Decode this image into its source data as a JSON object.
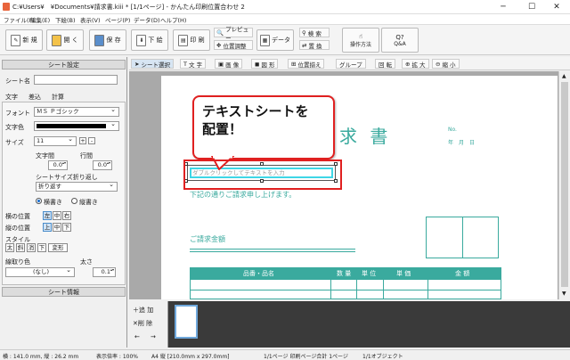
{
  "title": "C:¥Users¥　¥Documents¥請求書.kiii * [1/1ページ] - かんたん印刷位置合わせ 2",
  "menu": [
    "ファイル(F)",
    "編集(E)",
    "下絵(B)",
    "表示(V)",
    "ページ(P)",
    "データ(D)",
    "ヘルプ(H)"
  ],
  "toolbar": {
    "new": "新 規",
    "open": "開 く",
    "save": "保 存",
    "shita": "下 絵",
    "print": "印 刷",
    "preview": "プレビュー",
    "position": "位置調整",
    "data": "データ",
    "search": "検 索",
    "replace": "置 換",
    "howto": "操作方法",
    "qa": "Q&A"
  },
  "panel": {
    "sheet_settings": "シート設定",
    "sheet_name": "シート名",
    "tabs": [
      "文字",
      "差込",
      "計算"
    ],
    "font_label": "フォント",
    "font_value": "ＭＳ Ｐゴシック",
    "color_label": "文字色",
    "size_label": "サイズ",
    "size_value": "11",
    "moji_label": "文字間",
    "gyo_label": "行間",
    "moji_value": "0.0",
    "gyo_value": "0.0",
    "wrap_label": "シートサイズ折り返し",
    "wrap_value": "折り返す",
    "horizontal": "横書き",
    "vertical": "縦書き",
    "halign_label": "横の位置",
    "halign": [
      "左",
      "中",
      "右"
    ],
    "valign_label": "縦の位置",
    "valign": [
      "上",
      "中",
      "下"
    ],
    "style_label": "スタイル",
    "styles": [
      "太",
      "斜",
      "消",
      "下",
      "変形"
    ],
    "border_label": "線取り色",
    "border_value": "(なし)",
    "thick_label": "太さ",
    "thick_value": "0.1",
    "sheet_info": "シート情報"
  },
  "tool2": [
    "シート選択",
    "文 字",
    "画 像",
    "図 形",
    "位置揃え",
    "グループ",
    "回 転",
    "拡 大",
    "縮 小"
  ],
  "doc": {
    "title": "求 書",
    "no": "No.",
    "date": "年　月　日",
    "placeholder": "ダブルクリックしてテキストを入力",
    "request": "下記の通りご請求申し上げます。",
    "amount": "ご請求金額",
    "headers": [
      "品番・品名",
      "数 量",
      "単 位",
      "単 価",
      "金 額"
    ]
  },
  "callout": "テキストシートを\n配置！",
  "thumbs": {
    "add": "追 加",
    "del": "削 除"
  },
  "status": {
    "pos": "横 : 141.0 mm, 縦 : 26.2 mm",
    "zoom": "表示倍率 : 100%",
    "paper": "A4 縦 [210.0mm x 297.0mm]",
    "pages": "1/1ページ 印刷ページ合計 1ページ",
    "objects": "1/1オブジェクト"
  }
}
